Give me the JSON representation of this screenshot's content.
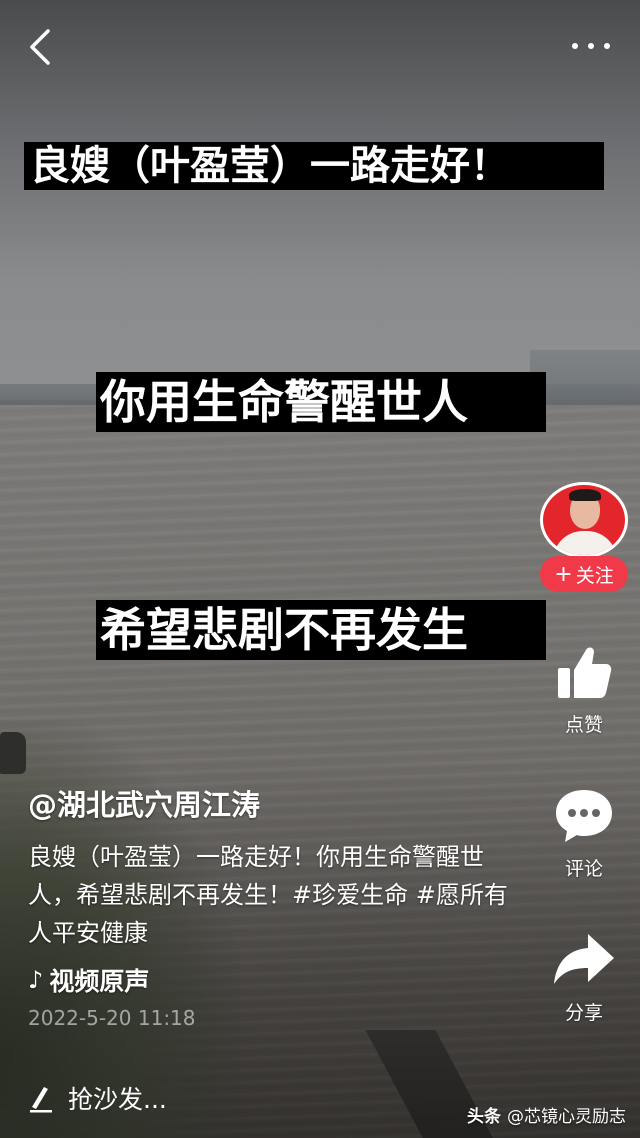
{
  "top_bar": {
    "back_icon": "chevron-left-icon",
    "more_icon": "more-dots-icon"
  },
  "captions": {
    "line1": "良嫂（叶盈莹）一路走好！",
    "line2": "你用生命警醒世人",
    "line3": "希望悲剧不再发生"
  },
  "rail": {
    "follow_plus": "+",
    "follow_label": "关注",
    "like_label": "点赞",
    "comment_label": "评论",
    "share_label": "分享"
  },
  "info": {
    "author": "@湖北武穴周江涛",
    "description": "良嫂（叶盈莹）一路走好！你用生命警醒世人，希望悲剧不再发生！#珍爱生命 #愿所有人平安健康",
    "music_label": "视频原声",
    "timestamp": "2022-5-20 11:18",
    "sofa_prompt": "抢沙发..."
  },
  "watermark": {
    "brand": "头条",
    "account": "@芯镜心灵励志"
  },
  "colors": {
    "follow_red": "#f03a4a",
    "caption_bg": "#000000",
    "text": "#ffffff"
  }
}
